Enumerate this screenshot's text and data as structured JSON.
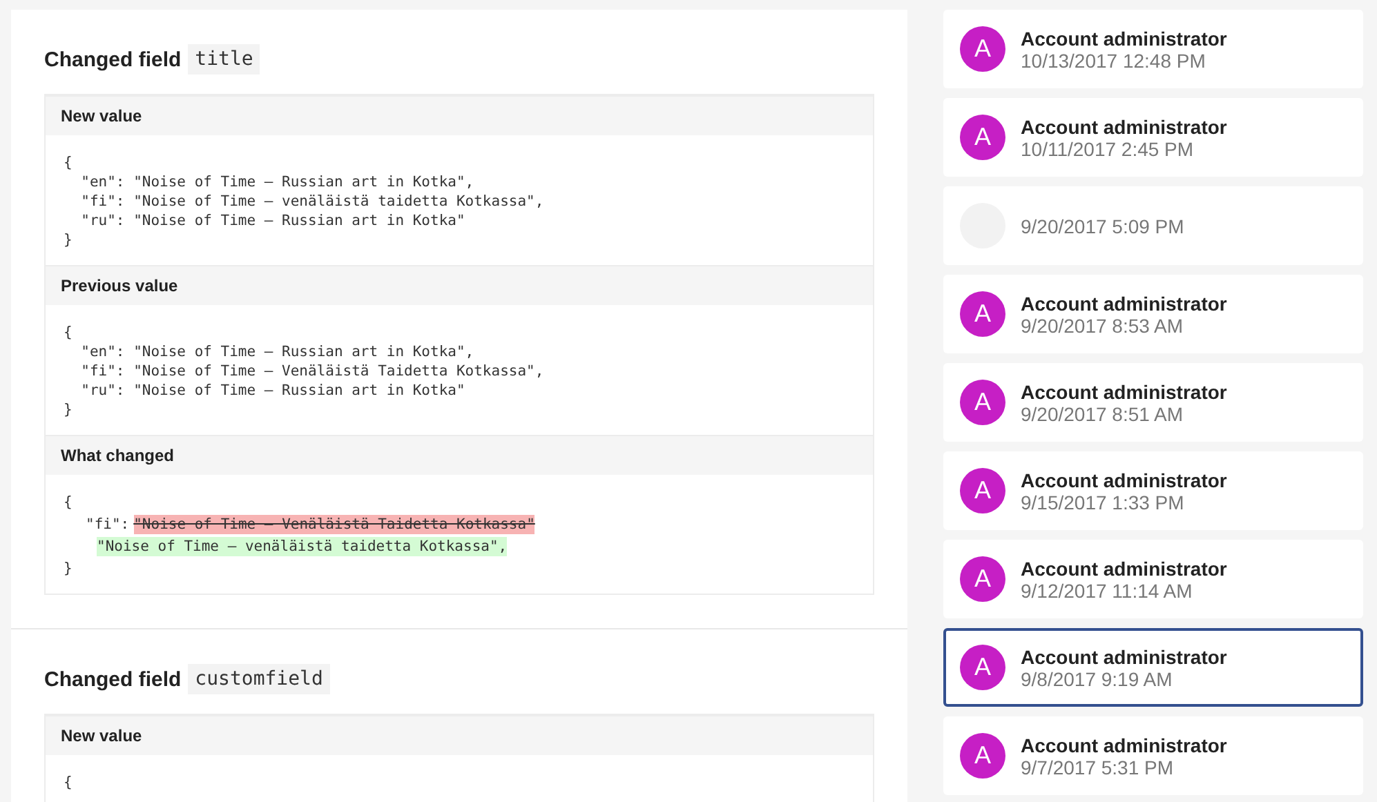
{
  "changes": [
    {
      "label": "Changed field",
      "field": "title",
      "blocks": [
        {
          "kind": "code",
          "label": "New value",
          "lines": [
            "{",
            "  \"en\": \"Noise of Time – Russian art in Kotka\",",
            "  \"fi\": \"Noise of Time – venäläistä taidetta Kotkassa\",",
            "  \"ru\": \"Noise of Time – Russian art in Kotka\"",
            "}"
          ]
        },
        {
          "kind": "code",
          "label": "Previous value",
          "lines": [
            "{",
            "  \"en\": \"Noise of Time – Russian art in Kotka\",",
            "  \"fi\": \"Noise of Time – Venäläistä Taidetta Kotkassa\",",
            "  \"ru\": \"Noise of Time – Russian art in Kotka\"",
            "}"
          ]
        },
        {
          "kind": "diff",
          "label": "What changed",
          "lines": [
            {
              "kind": "plain",
              "text": "{"
            },
            {
              "kind": "removed",
              "key": "\"fi\":",
              "text": "\"Noise of Time – Venäläistä Taidetta Kotkassa\""
            },
            {
              "kind": "added",
              "text": "\"Noise of Time – venäläistä taidetta Kotkassa\","
            },
            {
              "kind": "plain",
              "text": "}"
            }
          ]
        }
      ]
    },
    {
      "label": "Changed field",
      "field": "customfield",
      "blocks": [
        {
          "kind": "code",
          "label": "New value",
          "lines": [
            "{"
          ]
        }
      ]
    }
  ],
  "history": [
    {
      "avatar": "A",
      "name": "Account administrator",
      "time": "10/13/2017 12:48 PM",
      "selected": false
    },
    {
      "avatar": "A",
      "name": "Account administrator",
      "time": "10/11/2017 2:45 PM",
      "selected": false
    },
    {
      "time": "9/20/2017 5:09 PM",
      "selected": false
    },
    {
      "avatar": "A",
      "name": "Account administrator",
      "time": "9/20/2017 8:53 AM",
      "selected": false
    },
    {
      "avatar": "A",
      "name": "Account administrator",
      "time": "9/20/2017 8:51 AM",
      "selected": false
    },
    {
      "avatar": "A",
      "name": "Account administrator",
      "time": "9/15/2017 1:33 PM",
      "selected": false
    },
    {
      "avatar": "A",
      "name": "Account administrator",
      "time": "9/12/2017 11:14 AM",
      "selected": false
    },
    {
      "avatar": "A",
      "name": "Account administrator",
      "time": "9/8/2017 9:19 AM",
      "selected": true
    },
    {
      "avatar": "A",
      "name": "Account administrator",
      "time": "9/7/2017 5:31 PM",
      "selected": false
    }
  ]
}
